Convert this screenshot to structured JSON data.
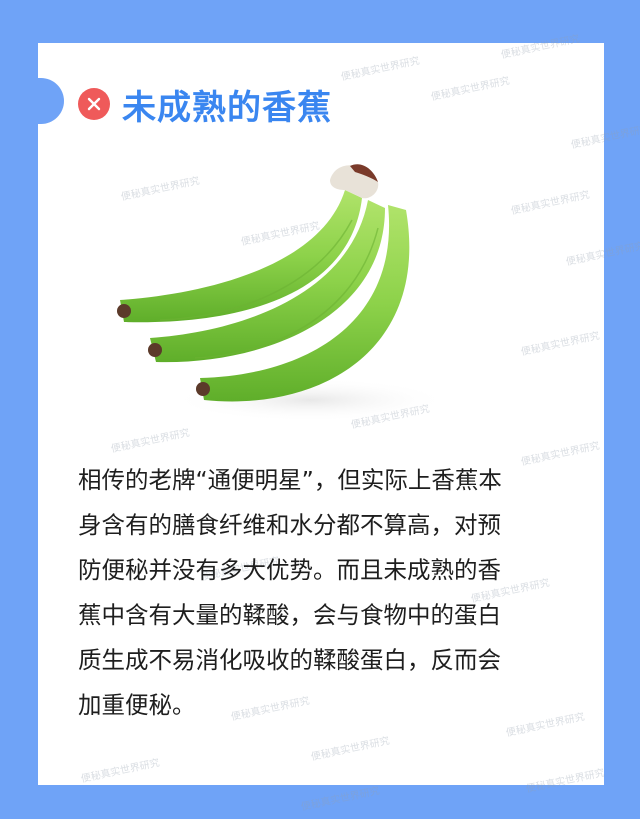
{
  "header": {
    "status_icon": "x-circle-icon",
    "title": "未成熟的香蕉"
  },
  "image": {
    "subject": "banana-bunch"
  },
  "body": {
    "lines": [
      "相传的老牌“通便明星”，但实际上香蕉本",
      "身含有的膳食纤维和水分都不算高，对预",
      "防便秘并没有多大优势。而且未成熟的香",
      "蕉中含有大量的鞣酸，会与食物中的蛋白",
      "质生成不易消化吸收的鞣酸蛋白，反而会",
      "加重便秘。"
    ]
  },
  "watermark": {
    "text": "便秘真实世界研究"
  },
  "colors": {
    "background": "#6fa3f7",
    "card": "#ffffff",
    "title": "#3a86f0",
    "badge": "#ef5a5a",
    "banana": "#8dd24a",
    "text": "#1e1e1e"
  }
}
